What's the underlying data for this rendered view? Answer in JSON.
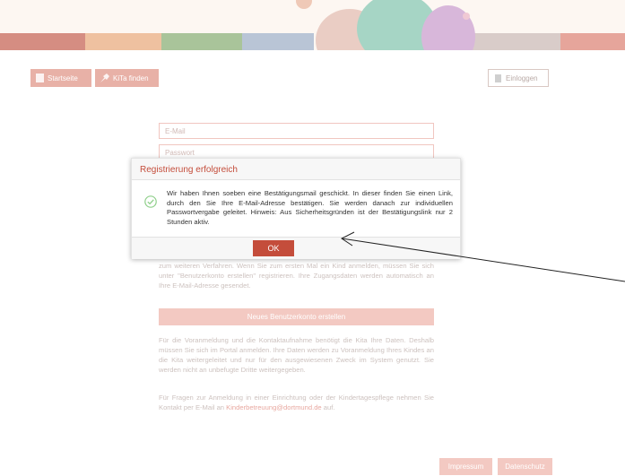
{
  "nav": {
    "home_label": "Startseite",
    "find_label": "KiTa finden",
    "login_label": "Einloggen"
  },
  "form": {
    "email_placeholder": "E-Mail",
    "password_placeholder": "Passwort",
    "info_text": "zum weiteren Verfahren. Wenn Sie zum ersten Mal ein Kind anmelden, müssen Sie sich unter \"Benutzerkonto erstellen\" registrieren. Ihre Zugangsdaten werden automatisch an Ihre E-Mail-Adresse gesendet.",
    "create_account_label": "Neues Benutzerkonto erstellen",
    "privacy_text": "Für die Voranmeldung und die Kontaktaufnahme benötigt die Kita Ihre Daten. Deshalb müssen Sie sich im Portal anmelden. Ihre Daten werden zu Voranmeldung Ihres Kindes an die Kita weitergeleitet und nur für den ausgewiesenen Zweck im System genutzt. Sie werden nicht an unbefugte Dritte weitergegeben.",
    "contact_prefix": "Für Fragen zur Anmeldung in einer Einrichtung oder der Kindertagespflege nehmen Sie Kontakt per E-Mail an",
    "contact_email": "Kinderbetreuung@dortmund.de",
    "contact_suffix": "auf."
  },
  "footer": {
    "impressum_label": "Impressum",
    "datenschutz_label": "Datenschutz"
  },
  "modal": {
    "title": "Registrierung erfolgreich",
    "message": "Wir haben Ihnen soeben eine Bestätigungsmail geschickt. In dieser finden Sie einen Link, durch den Sie Ihre E-Mail-Adresse bestätigen. Sie werden danach zur individuellen Passwortvergabe geleitet. Hinweis: Aus Sicherheitsgründen ist der Bestätigungslink nur 2 Stunden aktiv.",
    "ok_label": "OK",
    "success_icon": "check-circle-icon"
  },
  "colors": {
    "accent": "#c44d3b",
    "accent_light": "#f3c9c2"
  }
}
